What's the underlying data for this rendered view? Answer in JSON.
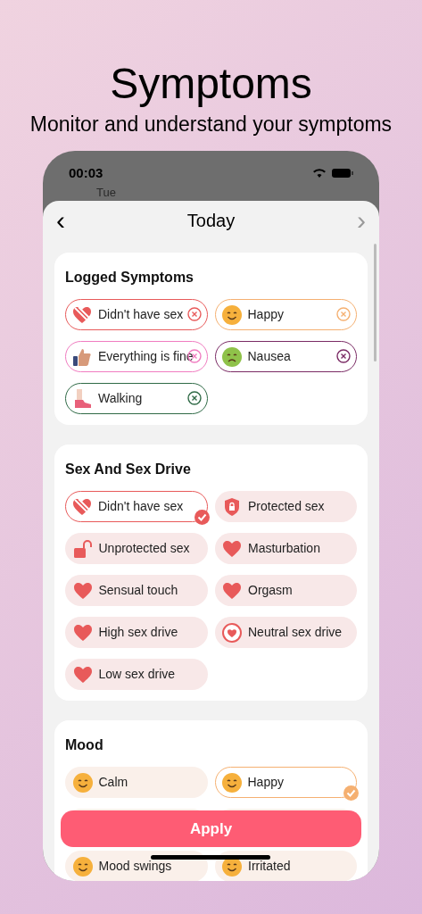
{
  "headline": {
    "title": "Symptoms",
    "subtitle": "Monitor and understand your symptoms"
  },
  "status_bar": {
    "time": "00:03",
    "weekday": "Tue"
  },
  "sheet": {
    "title": "Today",
    "back": "‹",
    "forward": "›"
  },
  "logged": {
    "title": "Logged Symptoms",
    "items": [
      {
        "label": "Didn't have sex",
        "color": "#e85a5a"
      },
      {
        "label": "Happy",
        "color": "#f5b071"
      },
      {
        "label": "Everything is fine",
        "color": "#f07cc0"
      },
      {
        "label": "Nausea",
        "color": "#7a2a64"
      },
      {
        "label": "Walking",
        "color": "#2f6a46"
      }
    ]
  },
  "sections": [
    {
      "title": "Sex And Sex Drive",
      "kind": "sex",
      "items": [
        {
          "label": "Didn't have sex",
          "selected": true
        },
        {
          "label": "Protected sex",
          "selected": false
        },
        {
          "label": "Unprotected sex",
          "selected": false
        },
        {
          "label": "Masturbation",
          "selected": false
        },
        {
          "label": "Sensual touch",
          "selected": false
        },
        {
          "label": "Orgasm",
          "selected": false
        },
        {
          "label": "High sex drive",
          "selected": false
        },
        {
          "label": "Neutral sex drive",
          "selected": false
        },
        {
          "label": "Low sex drive",
          "selected": false
        }
      ]
    },
    {
      "title": "Mood",
      "kind": "mood",
      "items": [
        {
          "label": "Calm",
          "selected": false
        },
        {
          "label": "Happy",
          "selected": true
        },
        {
          "label": "Mood swings",
          "selected": false
        },
        {
          "label": "Irritated",
          "selected": false
        }
      ]
    }
  ],
  "apply_button": "Apply"
}
